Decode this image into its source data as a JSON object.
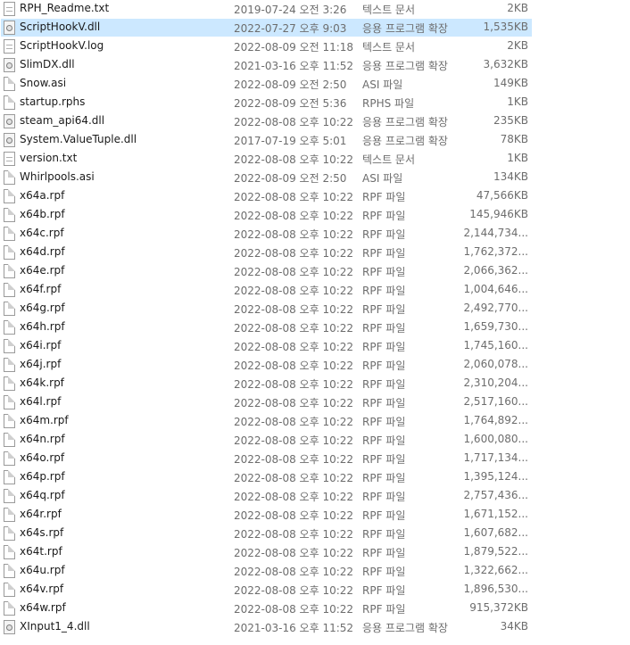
{
  "files": [
    {
      "name": "RPH_Readme.txt",
      "date": "2019-07-24 오전 3:26",
      "type": "텍스트 문서",
      "size": "2KB",
      "icon": "text-file-icon"
    },
    {
      "name": "ScriptHookV.dll",
      "date": "2022-07-27 오후 9:03",
      "type": "응용 프로그램 확장",
      "size": "1,535KB",
      "icon": "dll-file-icon",
      "selected": true
    },
    {
      "name": "ScriptHookV.log",
      "date": "2022-08-09 오전 11:18",
      "type": "텍스트 문서",
      "size": "2KB",
      "icon": "text-file-icon"
    },
    {
      "name": "SlimDX.dll",
      "date": "2021-03-16 오후 11:52",
      "type": "응용 프로그램 확장",
      "size": "3,632KB",
      "icon": "dll-file-icon"
    },
    {
      "name": "Snow.asi",
      "date": "2022-08-09 오전 2:50",
      "type": "ASI 파일",
      "size": "149KB",
      "icon": "blank-file-icon"
    },
    {
      "name": "startup.rphs",
      "date": "2022-08-09 오전 5:36",
      "type": "RPHS 파일",
      "size": "1KB",
      "icon": "blank-file-icon"
    },
    {
      "name": "steam_api64.dll",
      "date": "2022-08-08 오후 10:22",
      "type": "응용 프로그램 확장",
      "size": "235KB",
      "icon": "dll-file-icon"
    },
    {
      "name": "System.ValueTuple.dll",
      "date": "2017-07-19 오후 5:01",
      "type": "응용 프로그램 확장",
      "size": "78KB",
      "icon": "dll-file-icon"
    },
    {
      "name": "version.txt",
      "date": "2022-08-08 오후 10:22",
      "type": "텍스트 문서",
      "size": "1KB",
      "icon": "text-file-icon"
    },
    {
      "name": "Whirlpools.asi",
      "date": "2022-08-09 오전 2:50",
      "type": "ASI 파일",
      "size": "134KB",
      "icon": "blank-file-icon"
    },
    {
      "name": "x64a.rpf",
      "date": "2022-08-08 오후 10:22",
      "type": "RPF 파일",
      "size": "47,566KB",
      "icon": "blank-file-icon"
    },
    {
      "name": "x64b.rpf",
      "date": "2022-08-08 오후 10:22",
      "type": "RPF 파일",
      "size": "145,946KB",
      "icon": "blank-file-icon"
    },
    {
      "name": "x64c.rpf",
      "date": "2022-08-08 오후 10:22",
      "type": "RPF 파일",
      "size": "2,144,734...",
      "icon": "blank-file-icon"
    },
    {
      "name": "x64d.rpf",
      "date": "2022-08-08 오후 10:22",
      "type": "RPF 파일",
      "size": "1,762,372...",
      "icon": "blank-file-icon"
    },
    {
      "name": "x64e.rpf",
      "date": "2022-08-08 오후 10:22",
      "type": "RPF 파일",
      "size": "2,066,362...",
      "icon": "blank-file-icon"
    },
    {
      "name": "x64f.rpf",
      "date": "2022-08-08 오후 10:22",
      "type": "RPF 파일",
      "size": "1,004,646...",
      "icon": "blank-file-icon"
    },
    {
      "name": "x64g.rpf",
      "date": "2022-08-08 오후 10:22",
      "type": "RPF 파일",
      "size": "2,492,770...",
      "icon": "blank-file-icon"
    },
    {
      "name": "x64h.rpf",
      "date": "2022-08-08 오후 10:22",
      "type": "RPF 파일",
      "size": "1,659,730...",
      "icon": "blank-file-icon"
    },
    {
      "name": "x64i.rpf",
      "date": "2022-08-08 오후 10:22",
      "type": "RPF 파일",
      "size": "1,745,160...",
      "icon": "blank-file-icon"
    },
    {
      "name": "x64j.rpf",
      "date": "2022-08-08 오후 10:22",
      "type": "RPF 파일",
      "size": "2,060,078...",
      "icon": "blank-file-icon"
    },
    {
      "name": "x64k.rpf",
      "date": "2022-08-08 오후 10:22",
      "type": "RPF 파일",
      "size": "2,310,204...",
      "icon": "blank-file-icon"
    },
    {
      "name": "x64l.rpf",
      "date": "2022-08-08 오후 10:22",
      "type": "RPF 파일",
      "size": "2,517,160...",
      "icon": "blank-file-icon"
    },
    {
      "name": "x64m.rpf",
      "date": "2022-08-08 오후 10:22",
      "type": "RPF 파일",
      "size": "1,764,892...",
      "icon": "blank-file-icon"
    },
    {
      "name": "x64n.rpf",
      "date": "2022-08-08 오후 10:22",
      "type": "RPF 파일",
      "size": "1,600,080...",
      "icon": "blank-file-icon"
    },
    {
      "name": "x64o.rpf",
      "date": "2022-08-08 오후 10:22",
      "type": "RPF 파일",
      "size": "1,717,134...",
      "icon": "blank-file-icon"
    },
    {
      "name": "x64p.rpf",
      "date": "2022-08-08 오후 10:22",
      "type": "RPF 파일",
      "size": "1,395,124...",
      "icon": "blank-file-icon"
    },
    {
      "name": "x64q.rpf",
      "date": "2022-08-08 오후 10:22",
      "type": "RPF 파일",
      "size": "2,757,436...",
      "icon": "blank-file-icon"
    },
    {
      "name": "x64r.rpf",
      "date": "2022-08-08 오후 10:22",
      "type": "RPF 파일",
      "size": "1,671,152...",
      "icon": "blank-file-icon"
    },
    {
      "name": "x64s.rpf",
      "date": "2022-08-08 오후 10:22",
      "type": "RPF 파일",
      "size": "1,607,682...",
      "icon": "blank-file-icon"
    },
    {
      "name": "x64t.rpf",
      "date": "2022-08-08 오후 10:22",
      "type": "RPF 파일",
      "size": "1,879,522...",
      "icon": "blank-file-icon"
    },
    {
      "name": "x64u.rpf",
      "date": "2022-08-08 오후 10:22",
      "type": "RPF 파일",
      "size": "1,322,662...",
      "icon": "blank-file-icon"
    },
    {
      "name": "x64v.rpf",
      "date": "2022-08-08 오후 10:22",
      "type": "RPF 파일",
      "size": "1,896,530...",
      "icon": "blank-file-icon"
    },
    {
      "name": "x64w.rpf",
      "date": "2022-08-08 오후 10:22",
      "type": "RPF 파일",
      "size": "915,372KB",
      "icon": "blank-file-icon"
    },
    {
      "name": "XInput1_4.dll",
      "date": "2021-03-16 오후 11:52",
      "type": "응용 프로그램 확장",
      "size": "34KB",
      "icon": "dll-file-icon"
    }
  ],
  "colors": {
    "selection": "#cce8ff",
    "meta_text": "#6d6d6d"
  }
}
